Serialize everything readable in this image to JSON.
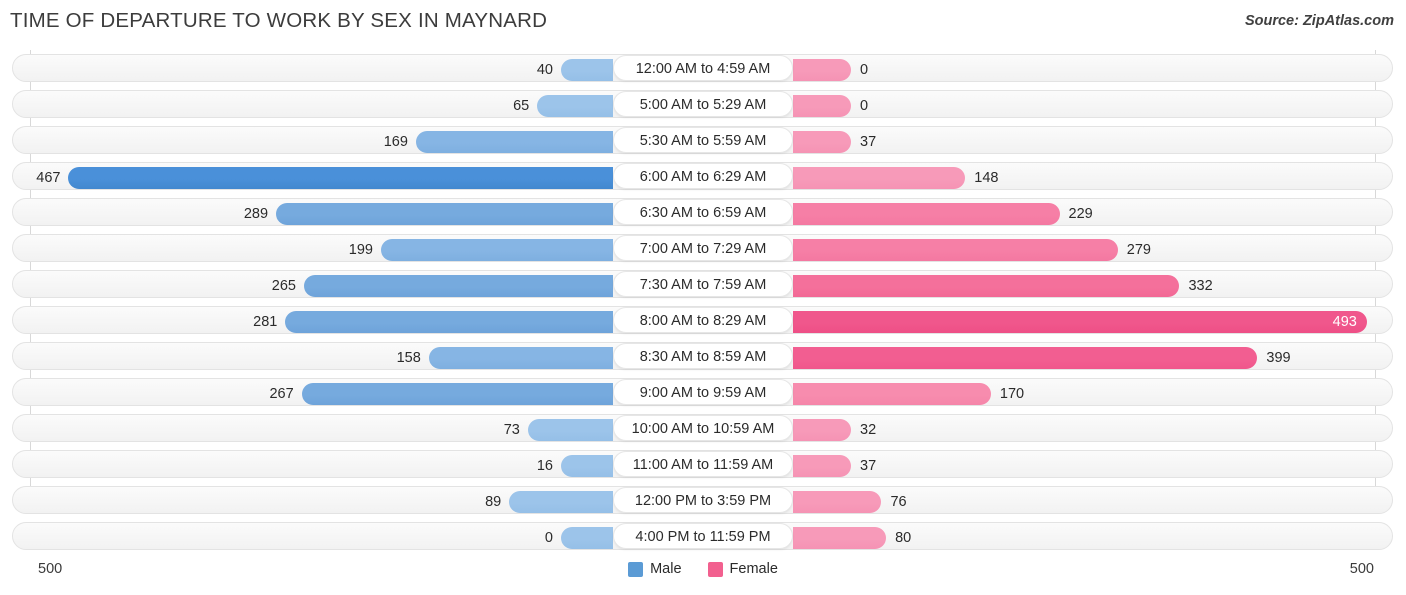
{
  "header": {
    "title": "TIME OF DEPARTURE TO WORK BY SEX IN MAYNARD",
    "source": "Source: ZipAtlas.com"
  },
  "legend": {
    "male_label": "Male",
    "female_label": "Female",
    "male_color": "#5b9bd5",
    "female_color": "#f2608f"
  },
  "axis": {
    "left_max_label": "500",
    "right_max_label": "500"
  },
  "chart_data": {
    "type": "bar",
    "orientation": "horizontal-diverging",
    "title": "TIME OF DEPARTURE TO WORK BY SEX IN MAYNARD",
    "subtitle": "",
    "xlabel": "",
    "ylabel": "",
    "xlim": [
      500,
      500
    ],
    "grid": true,
    "legend_position": "bottom-center",
    "categories": [
      "12:00 AM to 4:59 AM",
      "5:00 AM to 5:29 AM",
      "5:30 AM to 5:59 AM",
      "6:00 AM to 6:29 AM",
      "6:30 AM to 6:59 AM",
      "7:00 AM to 7:29 AM",
      "7:30 AM to 7:59 AM",
      "8:00 AM to 8:29 AM",
      "8:30 AM to 8:59 AM",
      "9:00 AM to 9:59 AM",
      "10:00 AM to 10:59 AM",
      "11:00 AM to 11:59 AM",
      "12:00 PM to 3:59 PM",
      "4:00 PM to 11:59 PM"
    ],
    "series": [
      {
        "name": "Male",
        "color": "#5b9bd5",
        "side": "left",
        "values": [
          40,
          65,
          169,
          467,
          289,
          199,
          265,
          281,
          158,
          267,
          73,
          16,
          89,
          0
        ]
      },
      {
        "name": "Female",
        "color": "#f2608f",
        "side": "right",
        "values": [
          0,
          0,
          37,
          148,
          229,
          279,
          332,
          493,
          399,
          170,
          32,
          37,
          76,
          80
        ]
      }
    ]
  }
}
